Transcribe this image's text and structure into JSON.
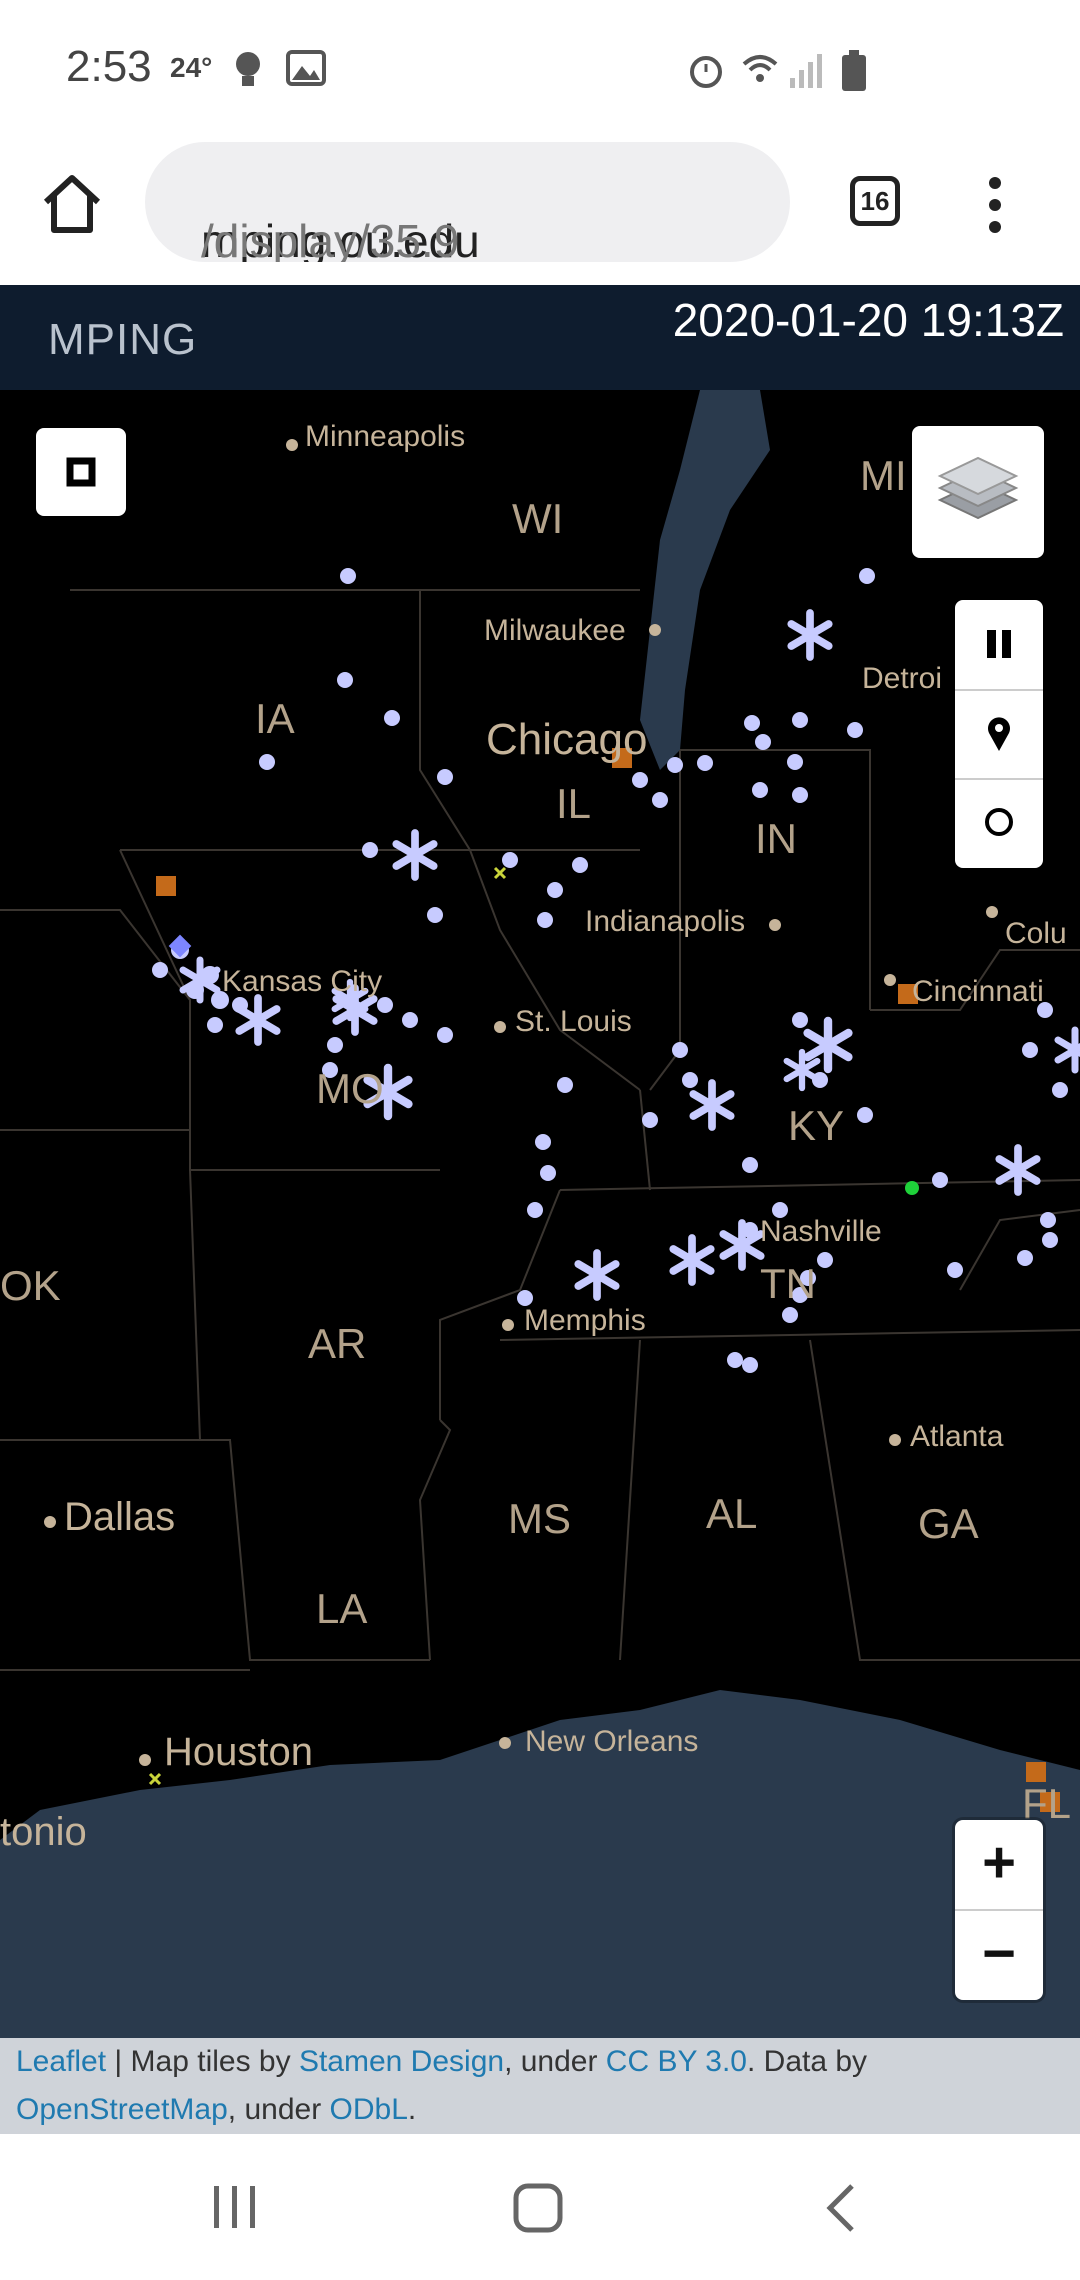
{
  "status_bar": {
    "time": "2:53",
    "temperature": "24°"
  },
  "browser": {
    "url_host": "mping.ou.edu",
    "url_path": "/display/35.9",
    "tab_count": "16"
  },
  "header": {
    "brand": "MPING",
    "timestamp": "2020-01-20 19:13Z"
  },
  "map": {
    "cities": [
      "Minneapolis",
      "Milwaukee",
      "Chicago",
      "Indianapolis",
      "Detroi",
      "Colu",
      "Kansas City",
      "St. Louis",
      "Cincinnati",
      "Nashville",
      "Memphis",
      "Atlanta",
      "Dallas",
      "Houston",
      "New Orleans",
      "tonio"
    ],
    "states": [
      "WI",
      "MI",
      "IA",
      "IL",
      "IN",
      "MO",
      "KY",
      "TN",
      "OK",
      "AR",
      "MS",
      "AL",
      "GA",
      "LA",
      "FL"
    ],
    "controls": {
      "zoom_in": "+",
      "zoom_out": "−"
    },
    "colors": {
      "water": "#2a3a4d",
      "land": "#000000",
      "report_snow": "#c7cbff",
      "report_orange": "#c46a1a",
      "report_green": "#1fd13a"
    }
  },
  "attribution": {
    "leaflet": "Leaflet",
    "sep": " | Map tiles by ",
    "stamen": "Stamen Design",
    "under1": ", under ",
    "cc": "CC BY 3.0",
    "data_by": ". Data by",
    "osm": "OpenStreetMap",
    "under2": ", under ",
    "odbl": "ODbL",
    "end": "."
  }
}
